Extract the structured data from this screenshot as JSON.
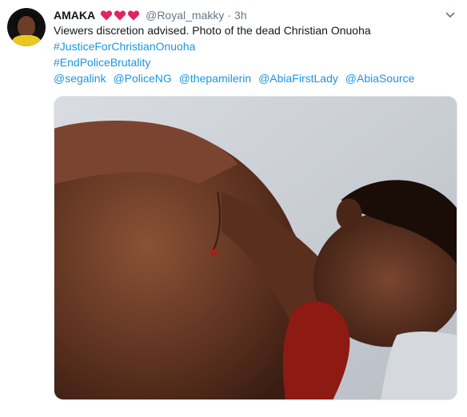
{
  "tweet": {
    "display_name": "AMAKA",
    "heart_emojis": [
      "red-heart",
      "red-heart",
      "red-heart"
    ],
    "handle": "@Royal_makky",
    "separator": "·",
    "timestamp": "3h",
    "text_line": "Viewers discretion advised. Photo of the dead Christian Onuoha",
    "hashtags": [
      "#JusticeForChristianOnuoha",
      "#EndPoliceBrutality"
    ],
    "mentions": [
      "@segalink",
      "@PoliceNG",
      "@thepamilerin",
      "@AbiaFirstLady",
      "@AbiaSource"
    ],
    "photo_icon": "tweet-photo-image"
  },
  "colors": {
    "link": "#1b95e0",
    "text": "#14171a",
    "muted": "#657786",
    "heart": "#e0245e"
  }
}
